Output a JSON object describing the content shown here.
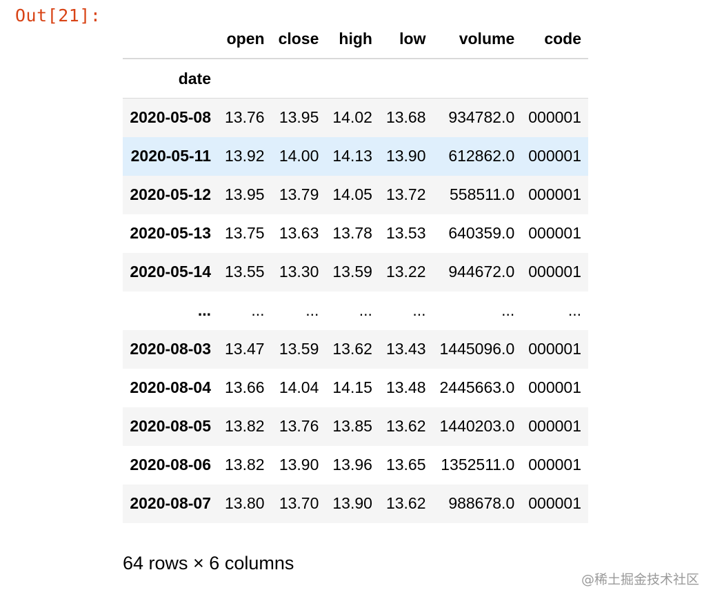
{
  "prompt": "Out[21]:",
  "table": {
    "index_name": "date",
    "columns": [
      "open",
      "close",
      "high",
      "low",
      "volume",
      "code"
    ],
    "rows": [
      {
        "date": "2020-05-08",
        "open": "13.76",
        "close": "13.95",
        "high": "14.02",
        "low": "13.68",
        "volume": "934782.0",
        "code": "000001"
      },
      {
        "date": "2020-05-11",
        "open": "13.92",
        "close": "14.00",
        "high": "14.13",
        "low": "13.90",
        "volume": "612862.0",
        "code": "000001",
        "highlighted": true
      },
      {
        "date": "2020-05-12",
        "open": "13.95",
        "close": "13.79",
        "high": "14.05",
        "low": "13.72",
        "volume": "558511.0",
        "code": "000001"
      },
      {
        "date": "2020-05-13",
        "open": "13.75",
        "close": "13.63",
        "high": "13.78",
        "low": "13.53",
        "volume": "640359.0",
        "code": "000001"
      },
      {
        "date": "2020-05-14",
        "open": "13.55",
        "close": "13.30",
        "high": "13.59",
        "low": "13.22",
        "volume": "944672.0",
        "code": "000001"
      },
      {
        "date": "...",
        "open": "...",
        "close": "...",
        "high": "...",
        "low": "...",
        "volume": "...",
        "code": "...",
        "ellipsis": true
      },
      {
        "date": "2020-08-03",
        "open": "13.47",
        "close": "13.59",
        "high": "13.62",
        "low": "13.43",
        "volume": "1445096.0",
        "code": "000001"
      },
      {
        "date": "2020-08-04",
        "open": "13.66",
        "close": "14.04",
        "high": "14.15",
        "low": "13.48",
        "volume": "2445663.0",
        "code": "000001"
      },
      {
        "date": "2020-08-05",
        "open": "13.82",
        "close": "13.76",
        "high": "13.85",
        "low": "13.62",
        "volume": "1440203.0",
        "code": "000001"
      },
      {
        "date": "2020-08-06",
        "open": "13.82",
        "close": "13.90",
        "high": "13.96",
        "low": "13.65",
        "volume": "1352511.0",
        "code": "000001"
      },
      {
        "date": "2020-08-07",
        "open": "13.80",
        "close": "13.70",
        "high": "13.90",
        "low": "13.62",
        "volume": "988678.0",
        "code": "000001"
      }
    ]
  },
  "footer": "64 rows × 6 columns",
  "watermark": "@稀土掘金技术社区",
  "colors": {
    "prompt": "#d84315",
    "row_highlight": "#dfeffc",
    "row_stripe": "#f5f5f5"
  }
}
